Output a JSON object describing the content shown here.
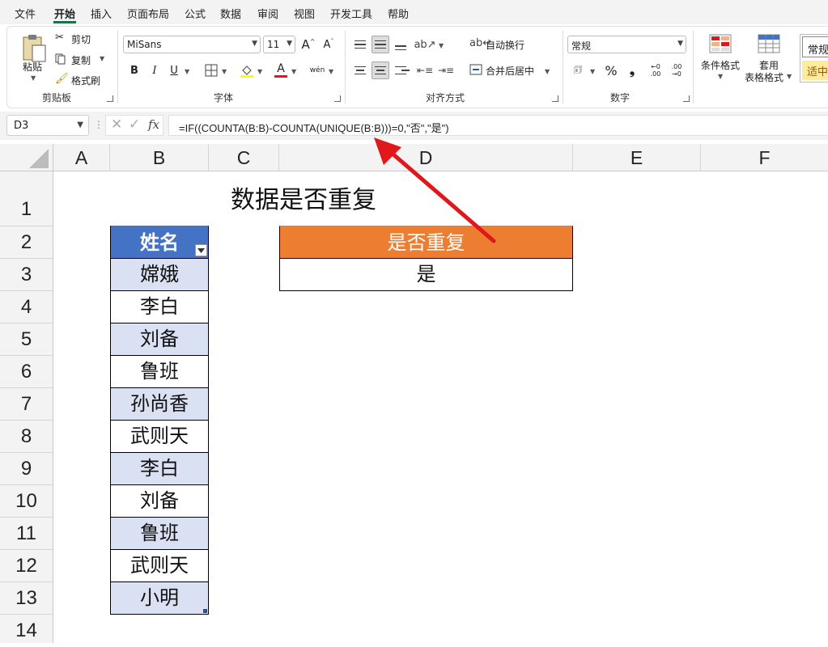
{
  "menu": [
    "文件",
    "开始",
    "插入",
    "页面布局",
    "公式",
    "数据",
    "审阅",
    "视图",
    "开发工具",
    "帮助"
  ],
  "clipboard": {
    "paste": "粘贴",
    "cut": "剪切",
    "copy": "复制",
    "format_painter": "格式刷",
    "group": "剪贴板"
  },
  "font": {
    "name": "MiSans",
    "size": "11",
    "bold": "B",
    "italic": "I",
    "underline": "U",
    "grow": "A",
    "shrink": "A",
    "font_color": "A",
    "phonetic": "wén",
    "group": "字体"
  },
  "alignment": {
    "wrap": "自动换行",
    "merge": "合并后居中",
    "group": "对齐方式"
  },
  "number": {
    "format": "常规",
    "percent": "%",
    "comma": "❟",
    "inc_decimal": "←0 .00",
    "dec_decimal": ".00 →0",
    "group": "数字"
  },
  "styles": {
    "conditional": "条件格式",
    "table1": "套用",
    "table2": "表格格式",
    "style_normal": "常规",
    "style_neutral": "适中"
  },
  "formula_bar": {
    "name_box": "D3",
    "formula": "=IF((COUNTA(B:B)-COUNTA(UNIQUE(B:B)))=0,\"否\",\"是\")",
    "fx": "fx"
  },
  "columns": [
    "A",
    "B",
    "C",
    "D",
    "E",
    "F"
  ],
  "rows": [
    "1",
    "2",
    "3",
    "4",
    "5",
    "6",
    "7",
    "8",
    "9",
    "10",
    "11",
    "12",
    "13",
    "14"
  ],
  "sheet": {
    "title": "数据是否重复",
    "name_header": "姓名",
    "names": [
      "嫦娥",
      "李白",
      "刘备",
      "鲁班",
      "孙尚香",
      "武则天",
      "李白",
      "刘备",
      "鲁班",
      "武则天",
      "小明"
    ],
    "result_header": "是否重复",
    "result_value": "是"
  },
  "colors": {
    "table_header": "#4472c4",
    "band": "#d9e1f2",
    "result_header": "#ed7d31",
    "arrow": "#e0181b",
    "accent": "#1e7145"
  }
}
